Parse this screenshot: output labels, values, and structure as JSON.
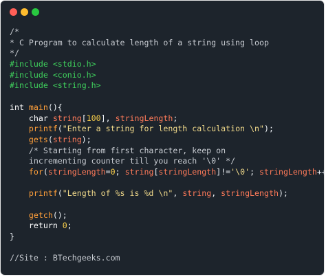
{
  "window": {
    "controls": [
      "close",
      "minimize",
      "maximize"
    ],
    "colors": {
      "background": "#1d242c",
      "close": "#ff5f57",
      "minimize": "#febc2e",
      "maximize": "#28c840"
    }
  },
  "code": {
    "lines": [
      [
        {
          "t": "/*",
          "k": "comment"
        }
      ],
      [
        {
          "t": "* C Program to calculate length of a string using loop",
          "k": "comment"
        }
      ],
      [
        {
          "t": "*/",
          "k": "comment"
        }
      ],
      [
        {
          "t": "#include <stdio.h>",
          "k": "pre"
        }
      ],
      [
        {
          "t": "#include <conio.h>",
          "k": "pre"
        }
      ],
      [
        {
          "t": "#include <string.h>",
          "k": "pre"
        }
      ],
      [],
      [
        {
          "t": "int ",
          "k": "kw"
        },
        {
          "t": "main",
          "k": "fn"
        },
        {
          "t": "(){",
          "k": "plain"
        }
      ],
      [
        {
          "t": "    char ",
          "k": "kw"
        },
        {
          "t": "string",
          "k": "var"
        },
        {
          "t": "[",
          "k": "plain"
        },
        {
          "t": "100",
          "k": "num"
        },
        {
          "t": "], ",
          "k": "plain"
        },
        {
          "t": "stringLength",
          "k": "var"
        },
        {
          "t": ";",
          "k": "plain"
        }
      ],
      [
        {
          "t": "    printf",
          "k": "fn"
        },
        {
          "t": "(",
          "k": "plain"
        },
        {
          "t": "\"Enter a string for length calculation \\n\"",
          "k": "str"
        },
        {
          "t": ");",
          "k": "plain"
        }
      ],
      [
        {
          "t": "    gets",
          "k": "fn"
        },
        {
          "t": "(",
          "k": "plain"
        },
        {
          "t": "string",
          "k": "var"
        },
        {
          "t": ");",
          "k": "plain"
        }
      ],
      [
        {
          "t": "    /* Starting from first character, keep on",
          "k": "comment"
        }
      ],
      [
        {
          "t": "    incrementing counter till you reach '\\0' */",
          "k": "comment"
        }
      ],
      [
        {
          "t": "    for",
          "k": "fn"
        },
        {
          "t": "(",
          "k": "plain"
        },
        {
          "t": "stringLength",
          "k": "var"
        },
        {
          "t": "=",
          "k": "plain"
        },
        {
          "t": "0",
          "k": "num"
        },
        {
          "t": "; ",
          "k": "plain"
        },
        {
          "t": "string",
          "k": "var"
        },
        {
          "t": "[",
          "k": "plain"
        },
        {
          "t": "stringLength",
          "k": "var"
        },
        {
          "t": "]!=",
          "k": "plain"
        },
        {
          "t": "'\\0'",
          "k": "str"
        },
        {
          "t": "; ",
          "k": "plain"
        },
        {
          "t": "stringLength",
          "k": "var"
        },
        {
          "t": "++);",
          "k": "plain"
        }
      ],
      [],
      [
        {
          "t": "    printf",
          "k": "fn"
        },
        {
          "t": "(",
          "k": "plain"
        },
        {
          "t": "\"Length of %s is %d \\n\"",
          "k": "str"
        },
        {
          "t": ", ",
          "k": "plain"
        },
        {
          "t": "string",
          "k": "var"
        },
        {
          "t": ", ",
          "k": "plain"
        },
        {
          "t": "stringLength",
          "k": "var"
        },
        {
          "t": ");",
          "k": "plain"
        }
      ],
      [],
      [
        {
          "t": "    getch",
          "k": "fn"
        },
        {
          "t": "();",
          "k": "plain"
        }
      ],
      [
        {
          "t": "    return ",
          "k": "kw"
        },
        {
          "t": "0",
          "k": "num"
        },
        {
          "t": ";",
          "k": "plain"
        }
      ],
      [
        {
          "t": "}",
          "k": "plain"
        }
      ],
      [],
      [
        {
          "t": "//Site : BTechgeeks.com",
          "k": "comment"
        }
      ]
    ]
  }
}
